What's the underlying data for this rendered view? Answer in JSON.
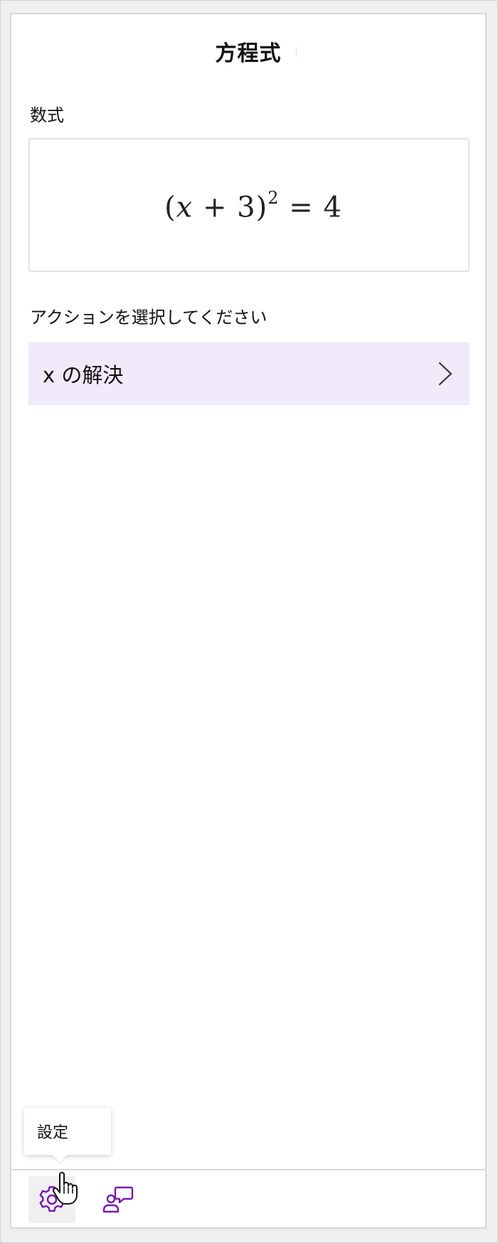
{
  "panel": {
    "title": "方程式"
  },
  "expression_section": {
    "label": "数式",
    "expression_lhs_open": "(",
    "expression_var": "x",
    "expression_mid": " + 3)",
    "expression_exp": "2",
    "expression_rhs": " = 4"
  },
  "action_section": {
    "label": "アクションを選択してください",
    "items": [
      {
        "label": "x の解決",
        "icon": "chevron-right-icon"
      }
    ]
  },
  "tooltip": {
    "text": "設定"
  },
  "toolbar": {
    "settings_icon": "gear-icon",
    "feedback_icon": "feedback-icon"
  },
  "colors": {
    "accent": "#7719aa",
    "action_background": "#f1eafa",
    "panel_background": "#ffffff",
    "outer_background": "#efefef"
  }
}
